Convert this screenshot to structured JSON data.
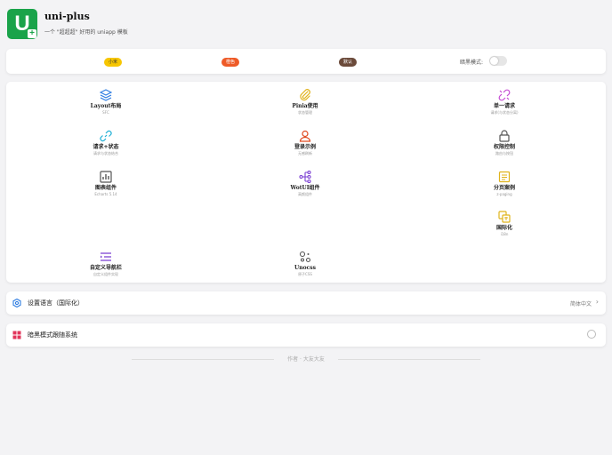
{
  "app": {
    "logo_letter": "U",
    "logo_plus": "+",
    "title": "uni-plus",
    "subtitle": "一个 \"超超超\" 好用的 uniapp 模板"
  },
  "theme": {
    "chips": [
      "小米",
      "橙色",
      "默认"
    ],
    "dark_mode_label": "暗黑模式:",
    "dark_mode_on": false
  },
  "grid": [
    {
      "label": "Layout布局",
      "sub": "SFC",
      "icon": "layers-icon",
      "color": "#2f7de1"
    },
    {
      "label": "Pinia使用",
      "sub": "状态管理",
      "icon": "paperclip-icon",
      "color": "#e0b31c"
    },
    {
      "label": "单一请求",
      "sub": "请求(与状态分离)",
      "icon": "link-broken-icon",
      "color": "#c54bd3"
    },
    {
      "label": "请求+状态",
      "sub": "请求与状态结合",
      "icon": "link-icon",
      "color": "#23b1d6"
    },
    {
      "label": "登录示例",
      "sub": "无感刷新",
      "icon": "user-icon",
      "color": "#e0491f"
    },
    {
      "label": "权限控制",
      "sub": "路由与按钮",
      "icon": "lock-icon",
      "color": "#555555"
    },
    {
      "label": "图表组件",
      "sub": "Echarts 5.14",
      "icon": "bar-chart-icon",
      "color": "#555555"
    },
    {
      "label": "WotUI组件",
      "sub": "高颜组件",
      "icon": "flow-icon",
      "color": "#7b3fd2"
    },
    {
      "label": "分页案例",
      "sub": "z-paging",
      "icon": "document-icon",
      "color": "#e0b31c"
    },
    {
      "label": "国际化",
      "sub": "i18n",
      "icon": "translate-icon",
      "color": "#e0b31c"
    },
    {
      "label": "自定义导航栏",
      "sub": "自定义组件实现",
      "icon": "list-nav-icon",
      "color": "#7b3fd2"
    },
    {
      "label": "Unocss",
      "sub": "原子CSS",
      "icon": "shapes-icon",
      "color": "#555555"
    }
  ],
  "settings": {
    "language_label": "设置语言（国际化）",
    "language_value": "简体中文",
    "dark_follow_label": "暗黑模式跟随系统"
  },
  "footer": {
    "text": "作者 · 大友大友"
  }
}
